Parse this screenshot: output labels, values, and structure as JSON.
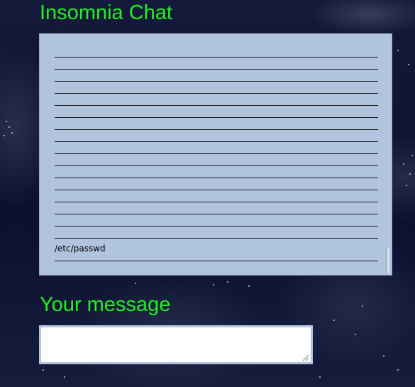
{
  "chat": {
    "title": "Insomnia Chat",
    "lines": [
      "",
      "",
      "",
      "",
      "",
      "",
      "",
      "",
      "",
      "",
      "",
      "",
      "",
      "",
      "",
      ""
    ],
    "last_message": "/etc/passwd"
  },
  "message": {
    "title": "Your message",
    "value": "",
    "placeholder": ""
  },
  "colors": {
    "title_green": "#21f021",
    "chat_background": "#b0c4de",
    "page_background": "#0d1231"
  },
  "icons": {
    "resize_grip": "resize-grip-icon"
  }
}
